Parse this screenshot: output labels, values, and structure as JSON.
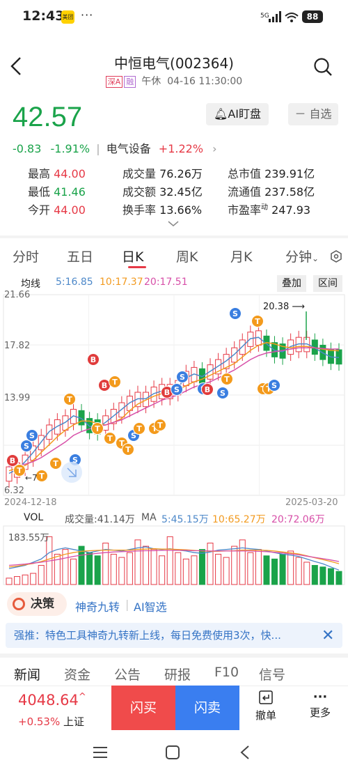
{
  "status": {
    "time": "12:43",
    "app_badge": "美团",
    "more": "···",
    "network": "5G",
    "battery": "88"
  },
  "header": {
    "title": "中恒电气(002364)",
    "tag_market": "深A",
    "tag_margin": "融",
    "session": "午休",
    "datetime": "04-16 11:30:00"
  },
  "quote": {
    "price": "42.57",
    "change": "-0.83",
    "change_pct": "-1.91%",
    "sector": "电气设备",
    "sector_change": "+1.22%",
    "ai_button": "AI盯盘",
    "watch_button": "自选"
  },
  "stats": [
    {
      "label": "最高",
      "value": "44.00",
      "tone": "red"
    },
    {
      "label": "成交量",
      "value": "76.26万",
      "tone": "dk"
    },
    {
      "label": "总市值",
      "value": "239.91亿",
      "tone": "dk"
    },
    {
      "label": "最低",
      "value": "41.46",
      "tone": "green"
    },
    {
      "label": "成交额",
      "value": "32.45亿",
      "tone": "dk"
    },
    {
      "label": "流通值",
      "value": "237.58亿",
      "tone": "dk"
    },
    {
      "label": "今开",
      "value": "44.00",
      "tone": "red"
    },
    {
      "label": "换手率",
      "value": "13.66%",
      "tone": "dk"
    },
    {
      "label": "市盈率",
      "value": "247.93",
      "tone": "dk",
      "sup": "动"
    }
  ],
  "tabs": [
    "分时",
    "五日",
    "日K",
    "周K",
    "月K",
    "分钟"
  ],
  "active_tab": "日K",
  "kline": {
    "ma_label": "均线",
    "ma5": "5:16.85",
    "ma10": "10:17.37",
    "ma20": "20:17.51",
    "btn_overlay": "叠加",
    "btn_range": "区间",
    "y_top": "21.66",
    "y_mid1": "17.82",
    "y_mid2": "13.99",
    "y_bottom": "6.32",
    "y_low_partial": "7",
    "max_marker": "20.38",
    "date_start": "2024-12-18",
    "date_end": "2025-03-20",
    "colors": {
      "up": "#e63946",
      "down": "#1aa34a",
      "ma5": "#4d88c9",
      "ma10": "#f29a1f",
      "ma20": "#d74fa8"
    }
  },
  "volume": {
    "label": "VOL",
    "vol_text": "成交量:41.14万",
    "ma_label": "MA",
    "ma5": "5:45.15万",
    "ma10": "10:65.27万",
    "ma20": "20:72.06万",
    "y_top": "183.55万"
  },
  "chart_data": [
    {
      "type": "line",
      "title": "",
      "xlabel": "",
      "ylabel": "",
      "x_range": [
        "2024-12-18",
        "2025-03-20"
      ],
      "ylim": [
        6.32,
        21.66
      ],
      "y_ticks": [
        21.66,
        17.82,
        13.99,
        6.32
      ],
      "max_marker": 20.38,
      "series": [
        {
          "name": "5",
          "values": [
            8.0,
            8.3,
            8.9,
            9.6,
            10.4,
            11.2,
            11.6,
            11.9,
            12.4,
            12.2,
            11.6,
            11.5,
            11.9,
            12.4,
            12.9,
            13.4,
            13.7,
            13.7,
            14.1,
            14.3,
            14.3,
            14.6,
            15.3,
            15.6,
            15.4,
            15.8,
            16.2,
            16.6,
            17.1,
            17.7,
            18.3,
            18.4,
            17.9,
            17.4,
            17.3,
            17.7,
            17.9,
            17.9,
            17.6,
            17.2,
            16.9,
            16.85
          ]
        },
        {
          "name": "10",
          "values": [
            8.2,
            8.4,
            8.6,
            9.0,
            9.6,
            10.2,
            10.8,
            11.3,
            11.7,
            12.0,
            12.0,
            11.8,
            11.7,
            11.9,
            12.2,
            12.8,
            13.3,
            13.6,
            13.9,
            14.1,
            14.2,
            14.4,
            14.7,
            15.0,
            15.2,
            15.5,
            15.8,
            16.1,
            16.4,
            16.9,
            17.4,
            17.8,
            18.0,
            17.9,
            17.7,
            17.6,
            17.7,
            17.7,
            17.6,
            17.5,
            17.4,
            17.37
          ]
        },
        {
          "name": "20",
          "values": [
            8.5,
            8.6,
            8.7,
            8.9,
            9.2,
            9.6,
            10.0,
            10.4,
            10.9,
            11.2,
            11.4,
            11.6,
            11.7,
            11.9,
            12.1,
            12.4,
            12.7,
            13.0,
            13.3,
            13.6,
            13.8,
            14.0,
            14.3,
            14.6,
            14.8,
            15.0,
            15.3,
            15.6,
            15.9,
            16.3,
            16.7,
            17.0,
            17.2,
            17.3,
            17.4,
            17.5,
            17.6,
            17.6,
            17.6,
            17.55,
            17.5,
            17.51
          ]
        }
      ]
    },
    {
      "type": "bar",
      "title": "",
      "ylabel": "",
      "ylim": [
        0,
        183.55
      ],
      "unit": "万",
      "values": [
        20,
        25,
        30,
        35,
        60,
        150,
        95,
        110,
        80,
        120,
        100,
        90,
        130,
        95,
        85,
        100,
        140,
        120,
        110,
        90,
        150,
        100,
        80,
        90,
        110,
        130,
        95,
        85,
        120,
        140,
        100,
        110,
        90,
        80,
        95,
        105,
        85,
        70,
        60,
        55,
        50,
        41.14
      ],
      "series": [
        {
          "name": "5",
          "values": [
            50,
            55,
            60,
            70,
            80,
            100,
            110,
            115,
            110,
            105,
            100,
            105,
            110,
            108,
            105,
            110,
            115,
            118,
            112,
            110,
            112,
            108,
            105,
            100,
            98,
            102,
            108,
            110,
            112,
            115,
            112,
            110,
            105,
            100,
            95,
            92,
            88,
            80,
            72,
            65,
            55,
            45.15
          ]
        },
        {
          "name": "10",
          "values": [
            55,
            58,
            62,
            66,
            72,
            80,
            88,
            95,
            100,
            104,
            106,
            107,
            108,
            108,
            108,
            108,
            110,
            111,
            112,
            111,
            111,
            110,
            109,
            107,
            105,
            104,
            104,
            105,
            106,
            108,
            108,
            108,
            107,
            105,
            102,
            99,
            96,
            90,
            84,
            78,
            72,
            65.27
          ]
        },
        {
          "name": "20",
          "values": [
            60,
            62,
            64,
            67,
            70,
            74,
            78,
            83,
            88,
            92,
            95,
            98,
            100,
            102,
            103,
            104,
            105,
            106,
            106,
            107,
            107,
            107,
            107,
            106,
            106,
            105,
            105,
            105,
            105,
            105,
            105,
            104,
            103,
            101,
            99,
            96,
            93,
            89,
            85,
            81,
            77,
            72.06
          ]
        }
      ]
    }
  ],
  "tools": {
    "pill": "决策",
    "link1": "神奇九转",
    "link2": "AI智选"
  },
  "notice": {
    "text": "强推：特色工具神奇九转新上线，每日免费使用3次，快..."
  },
  "bottom_tabs": [
    "新闻",
    "资金",
    "公告",
    "研报",
    "F10",
    "信号"
  ],
  "index": {
    "value": "4048.64",
    "arrow": "^",
    "change": "+0.53%",
    "name": "上证"
  },
  "actions": {
    "buy": "闪买",
    "sell": "闪卖",
    "cancel": "撤单",
    "more": "更多"
  }
}
